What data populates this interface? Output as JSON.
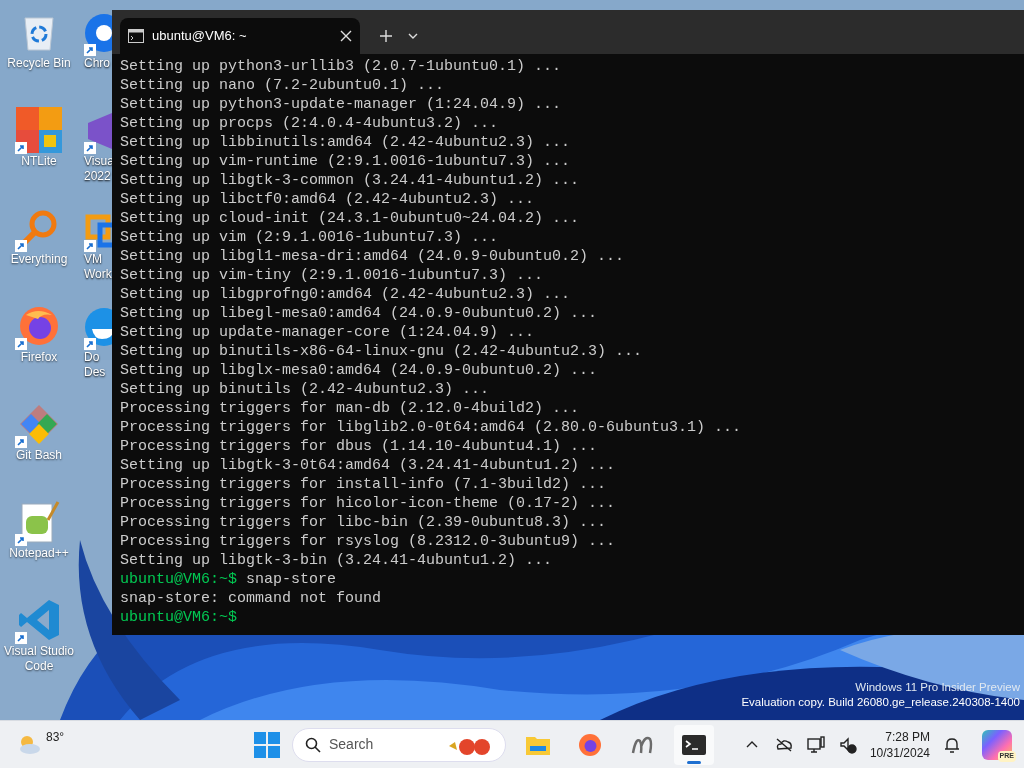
{
  "desktop_icons": [
    {
      "label": "Recycle Bin",
      "kind": "recycle",
      "shortcut": false
    },
    {
      "label": "NTLite",
      "kind": "ntlite",
      "shortcut": true
    },
    {
      "label": "Everything",
      "kind": "everything",
      "shortcut": true
    },
    {
      "label": "Firefox",
      "kind": "firefox",
      "shortcut": true
    },
    {
      "label": "Git Bash",
      "kind": "git",
      "shortcut": true
    },
    {
      "label": "Notepad++",
      "kind": "notepad",
      "shortcut": true
    },
    {
      "label": "Visual Studio Code",
      "kind": "vscode",
      "shortcut": true
    }
  ],
  "desktop_icons_partial": [
    {
      "label": "Chro",
      "kind": "chrome"
    },
    {
      "label": "Visua 2022",
      "kind": "vs"
    },
    {
      "label": "VM Work",
      "kind": "vmware"
    },
    {
      "label": "Do Des",
      "kind": "docker"
    }
  ],
  "terminal": {
    "tab_title": "ubuntu@VM6: ~",
    "lines": [
      {
        "kind": "output",
        "text": "Setting up python3-urllib3 (2.0.7-1ubuntu0.1) ..."
      },
      {
        "kind": "output",
        "text": "Setting up nano (7.2-2ubuntu0.1) ..."
      },
      {
        "kind": "output",
        "text": "Setting up python3-update-manager (1:24.04.9) ..."
      },
      {
        "kind": "output",
        "text": "Setting up procps (2:4.0.4-4ubuntu3.2) ..."
      },
      {
        "kind": "output",
        "text": "Setting up libbinutils:amd64 (2.42-4ubuntu2.3) ..."
      },
      {
        "kind": "output",
        "text": "Setting up vim-runtime (2:9.1.0016-1ubuntu7.3) ..."
      },
      {
        "kind": "output",
        "text": "Setting up libgtk-3-common (3.24.41-4ubuntu1.2) ..."
      },
      {
        "kind": "output",
        "text": "Setting up libctf0:amd64 (2.42-4ubuntu2.3) ..."
      },
      {
        "kind": "output",
        "text": "Setting up cloud-init (24.3.1-0ubuntu0~24.04.2) ..."
      },
      {
        "kind": "output",
        "text": "Setting up vim (2:9.1.0016-1ubuntu7.3) ..."
      },
      {
        "kind": "output",
        "text": "Setting up libgl1-mesa-dri:amd64 (24.0.9-0ubuntu0.2) ..."
      },
      {
        "kind": "output",
        "text": "Setting up vim-tiny (2:9.1.0016-1ubuntu7.3) ..."
      },
      {
        "kind": "output",
        "text": "Setting up libgprofng0:amd64 (2.42-4ubuntu2.3) ..."
      },
      {
        "kind": "output",
        "text": "Setting up libegl-mesa0:amd64 (24.0.9-0ubuntu0.2) ..."
      },
      {
        "kind": "output",
        "text": "Setting up update-manager-core (1:24.04.9) ..."
      },
      {
        "kind": "output",
        "text": "Setting up binutils-x86-64-linux-gnu (2.42-4ubuntu2.3) ..."
      },
      {
        "kind": "output",
        "text": "Setting up libglx-mesa0:amd64 (24.0.9-0ubuntu0.2) ..."
      },
      {
        "kind": "output",
        "text": "Setting up binutils (2.42-4ubuntu2.3) ..."
      },
      {
        "kind": "output",
        "text": "Processing triggers for man-db (2.12.0-4build2) ..."
      },
      {
        "kind": "output",
        "text": "Processing triggers for libglib2.0-0t64:amd64 (2.80.0-6ubuntu3.1) ..."
      },
      {
        "kind": "output",
        "text": "Processing triggers for dbus (1.14.10-4ubuntu4.1) ..."
      },
      {
        "kind": "output",
        "text": "Setting up libgtk-3-0t64:amd64 (3.24.41-4ubuntu1.2) ..."
      },
      {
        "kind": "output",
        "text": "Processing triggers for install-info (7.1-3build2) ..."
      },
      {
        "kind": "output",
        "text": "Processing triggers for hicolor-icon-theme (0.17-2) ..."
      },
      {
        "kind": "output",
        "text": "Processing triggers for libc-bin (2.39-0ubuntu8.3) ..."
      },
      {
        "kind": "output",
        "text": "Processing triggers for rsyslog (8.2312.0-3ubuntu9) ..."
      },
      {
        "kind": "output",
        "text": "Setting up libgtk-3-bin (3.24.41-4ubuntu1.2) ..."
      },
      {
        "kind": "prompt",
        "prompt": "ubuntu@VM6:~$",
        "text": "snap-store"
      },
      {
        "kind": "output",
        "text": "snap-store: command not found"
      },
      {
        "kind": "prompt",
        "prompt": "ubuntu@VM6:~$"
      }
    ]
  },
  "watermark": {
    "edition": "Windows 11 Pro Insider Preview",
    "build": "Evaluation copy. Build 26080.ge_release.240308-1400"
  },
  "taskbar": {
    "weather": "83°",
    "search_placeholder": "Search",
    "apps": [
      {
        "kind": "explorer",
        "selected": false
      },
      {
        "kind": "firefox",
        "selected": false
      },
      {
        "kind": "app",
        "selected": false
      },
      {
        "kind": "terminal",
        "selected": true
      }
    ],
    "time": "7:28 PM",
    "date": "10/31/2024",
    "copilot_badge": "PRE"
  }
}
